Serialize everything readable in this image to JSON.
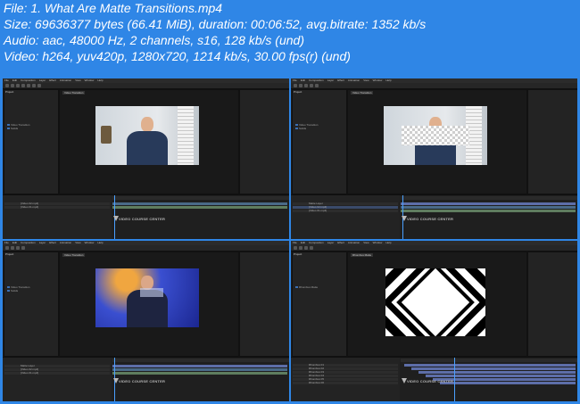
{
  "file_info": {
    "line1": "File: 1. What Are Matte Transitions.mp4",
    "line2": "Size: 69636377 bytes (66.41 MiB), duration: 00:06:52, avg.bitrate: 1352 kb/s",
    "line3": "Audio: aac, 48000 Hz, 2 channels, s16, 128 kb/s (und)",
    "line4": "Video: h264, yuv420p, 1280x720, 1214 kb/s, 30.00 fps(r) (und)"
  },
  "menu": [
    "File",
    "Edit",
    "Composition",
    "Layer",
    "Effect",
    "Animation",
    "View",
    "Window",
    "Help"
  ],
  "thumbnails": [
    {
      "project_tab": "Project",
      "comp_tab": "Video Transition",
      "rows": [
        "Video Transition",
        "Solids"
      ],
      "layers": [
        "[Video 02.mp4]",
        "[Video 01.mp4]"
      ],
      "watermark": "VIDEO COURSE CENTER"
    },
    {
      "project_tab": "Project",
      "comp_tab": "Video Transition",
      "rows": [
        "Video Transition",
        "Solids"
      ],
      "layers": [
        "Matte Layer",
        "[Video 02.mp4]",
        "[Video 01.mp4]"
      ],
      "watermark": "VIDEO COURSE CENTER"
    },
    {
      "project_tab": "Project",
      "comp_tab": "Video Transition",
      "rows": [
        "Video Transition",
        "Solids"
      ],
      "layers": [
        "Matte Layer",
        "[Video 02.mp4]",
        "[Video 01.mp4]"
      ],
      "watermark": "VIDEO COURSE CENTER"
    },
    {
      "project_tab": "Project",
      "comp_tab": "Rhombus Matte",
      "rows": [
        "Rhombus Matte"
      ],
      "layers": [
        "Rhombus 01",
        "Rhombus 02",
        "Rhombus 03",
        "Rhombus 04",
        "Rhombus 05",
        "Rhombus 06"
      ],
      "watermark": "VIDEO COURSE CENTER"
    }
  ],
  "colors": {
    "background": "#2f86e6",
    "panel": "#232323",
    "accent": "#4aa0ff"
  }
}
